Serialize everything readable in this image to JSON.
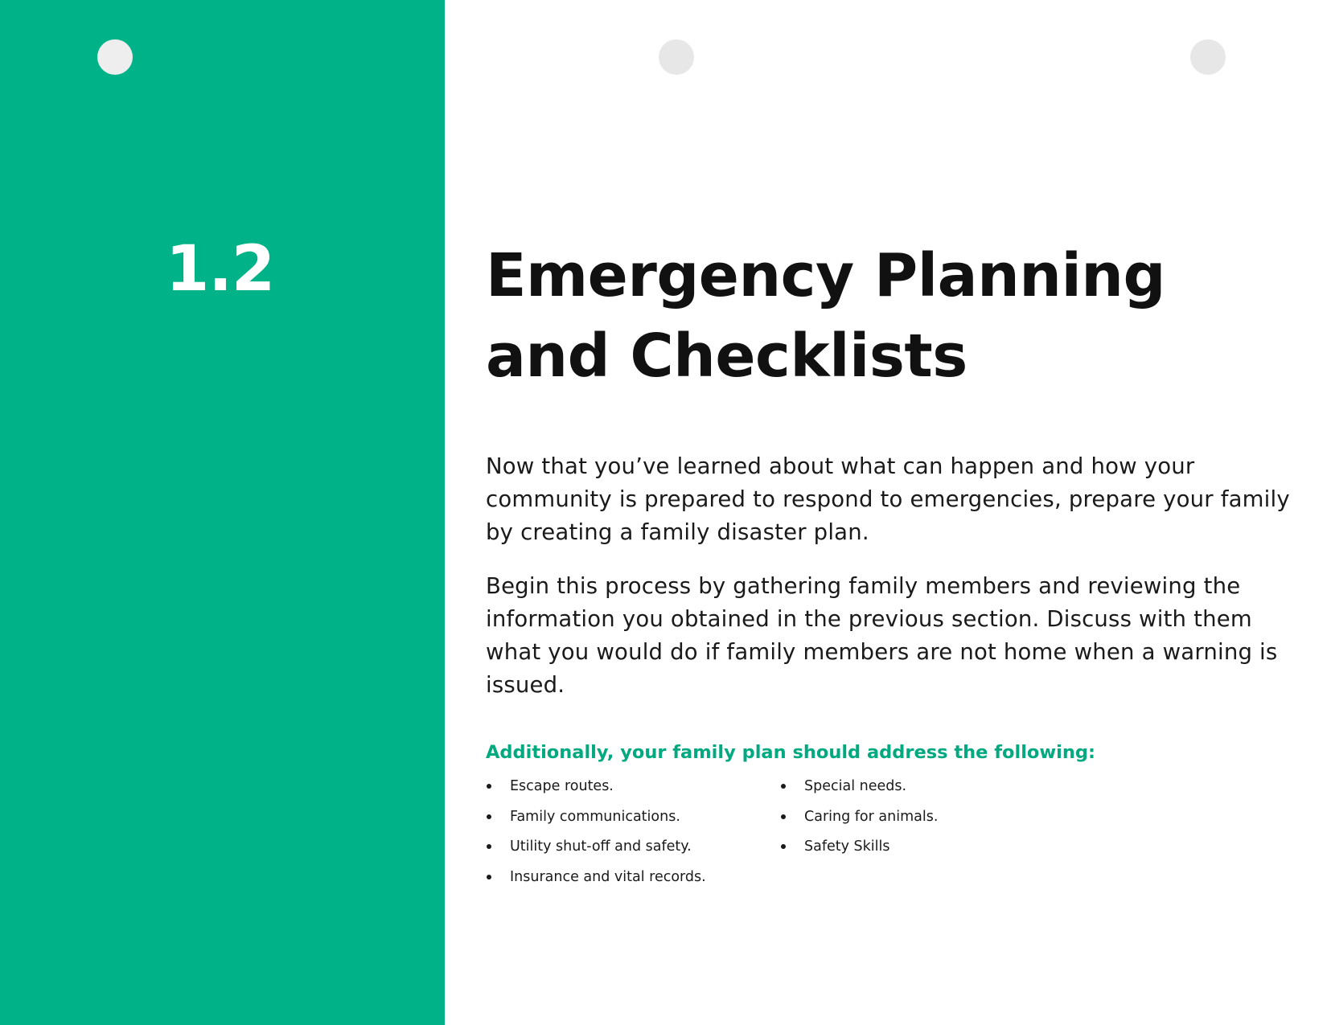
{
  "section": {
    "number": "1.2"
  },
  "title": {
    "line1": "Emergency Planning",
    "line2": "and Checklists"
  },
  "body": {
    "paragraph1": "Now that you’ve learned about what can happen and how your community is prepared to respond to emergencies, prepare your family by creating a family disaster plan.",
    "paragraph2": "Begin this process by gathering family members and reviewing the information you obtained in the previous section. Discuss with them what you would do if family members are not home when a warning is issued."
  },
  "checklist": {
    "heading": "Additionally, your family plan should address the following:",
    "left_items": [
      "Escape routes.",
      "Family communications.",
      "Utility shut-off and safety.",
      "Insurance and vital records."
    ],
    "right_items": [
      "Special needs.",
      "Caring for animals.",
      "Safety Skills"
    ]
  },
  "colors": {
    "accent": "#00b288",
    "heading_text": "#00a97f",
    "body_text": "#1a1a1a",
    "background": "#ffffff"
  }
}
